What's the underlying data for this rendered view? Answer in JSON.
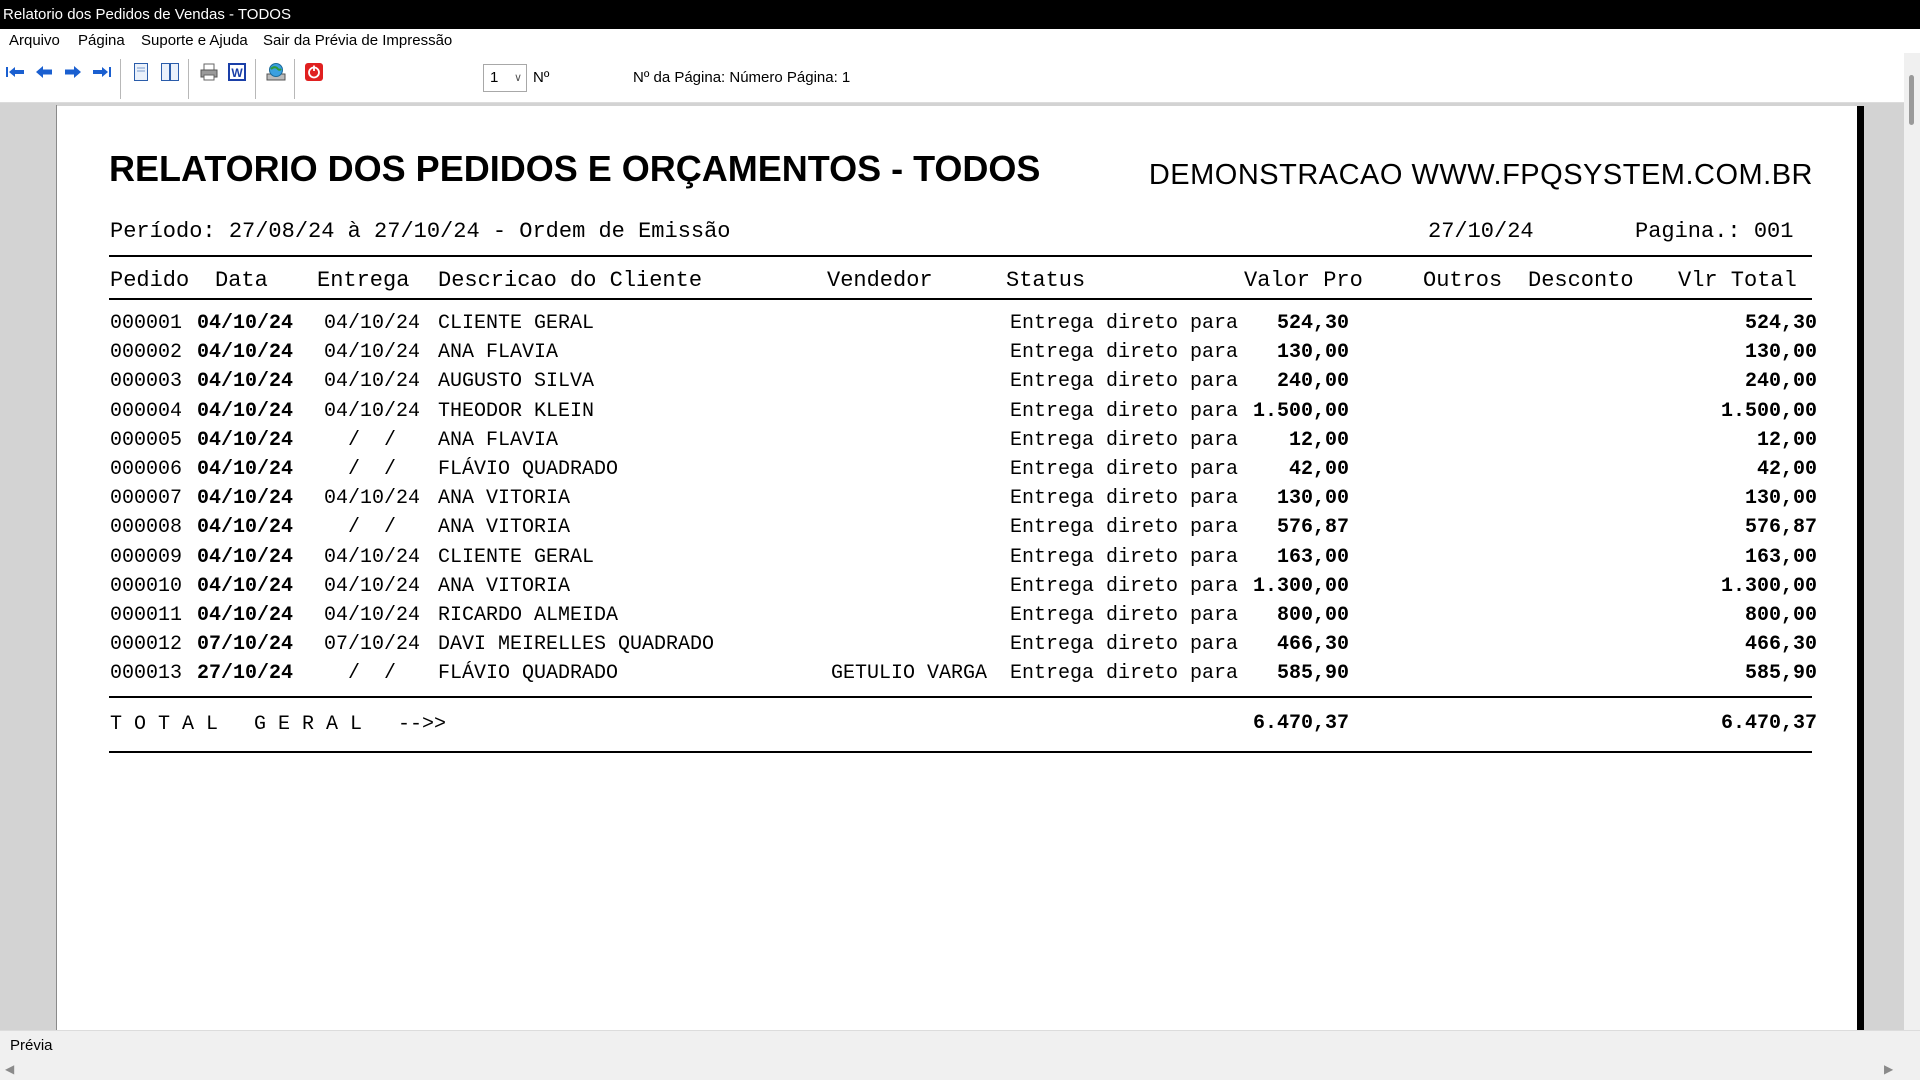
{
  "window": {
    "title": "Relatorio dos Pedidos de Vendas - TODOS"
  },
  "menu": {
    "items": [
      "Arquivo",
      "Página",
      "Suporte e Ajuda",
      "Sair da Prévia de Impressão"
    ]
  },
  "toolbar": {
    "page_value": "1",
    "page_suffix": "Nº",
    "page_info": "Nº da Página: Número Página: 1",
    "icons": [
      "first-page-icon",
      "prev-page-icon",
      "next-page-icon",
      "last-page-icon",
      "single-page-icon",
      "two-page-icon",
      "print-icon",
      "word-export-icon",
      "web-export-icon",
      "close-preview-icon"
    ],
    "colors": {
      "nav_arrow": "#1a5fd0",
      "word": "#1a3fa8",
      "stop": "#e02020"
    }
  },
  "report": {
    "title": "RELATORIO DOS PEDIDOS E ORÇAMENTOS - TODOS",
    "company": "DEMONSTRACAO WWW.FPQSYSTEM.COM.BR",
    "period": "Período: 27/08/24 à 27/10/24 - Ordem de Emissão",
    "date": "27/10/24",
    "page": "Pagina.: 001",
    "columns": {
      "pedido": "Pedido",
      "data": "Data",
      "entrega": "Entrega",
      "cliente": "Descricao do Cliente",
      "vendedor": "Vendedor",
      "status": "Status",
      "valor": "Valor Pro",
      "outros": "Outros",
      "desconto": "Desconto",
      "total": "Vlr Total"
    },
    "rows": [
      {
        "pedido": "000001",
        "data": "04/10/24",
        "entrega": "04/10/24",
        "cliente": "CLIENTE GERAL",
        "vendedor": "",
        "status": "Entrega direto para",
        "valor": "524,30",
        "total": "524,30"
      },
      {
        "pedido": "000002",
        "data": "04/10/24",
        "entrega": "04/10/24",
        "cliente": "ANA FLAVIA",
        "vendedor": "",
        "status": "Entrega direto para",
        "valor": "130,00",
        "total": "130,00"
      },
      {
        "pedido": "000003",
        "data": "04/10/24",
        "entrega": "04/10/24",
        "cliente": "AUGUSTO SILVA",
        "vendedor": "",
        "status": "Entrega direto para",
        "valor": "240,00",
        "total": "240,00"
      },
      {
        "pedido": "000004",
        "data": "04/10/24",
        "entrega": "04/10/24",
        "cliente": "THEODOR KLEIN",
        "vendedor": "",
        "status": "Entrega direto para",
        "valor": "1.500,00",
        "total": "1.500,00"
      },
      {
        "pedido": "000005",
        "data": "04/10/24",
        "entrega": "  /  /",
        "cliente": "ANA FLAVIA",
        "vendedor": "",
        "status": "Entrega direto para",
        "valor": "12,00",
        "total": "12,00"
      },
      {
        "pedido": "000006",
        "data": "04/10/24",
        "entrega": "  /  /",
        "cliente": "FLÁVIO QUADRADO",
        "vendedor": "",
        "status": "Entrega direto para",
        "valor": "42,00",
        "total": "42,00"
      },
      {
        "pedido": "000007",
        "data": "04/10/24",
        "entrega": "04/10/24",
        "cliente": "ANA VITORIA",
        "vendedor": "",
        "status": "Entrega direto para",
        "valor": "130,00",
        "total": "130,00"
      },
      {
        "pedido": "000008",
        "data": "04/10/24",
        "entrega": "  /  /",
        "cliente": "ANA VITORIA",
        "vendedor": "",
        "status": "Entrega direto para",
        "valor": "576,87",
        "total": "576,87"
      },
      {
        "pedido": "000009",
        "data": "04/10/24",
        "entrega": "04/10/24",
        "cliente": "CLIENTE GERAL",
        "vendedor": "",
        "status": "Entrega direto para",
        "valor": "163,00",
        "total": "163,00"
      },
      {
        "pedido": "000010",
        "data": "04/10/24",
        "entrega": "04/10/24",
        "cliente": "ANA VITORIA",
        "vendedor": "",
        "status": "Entrega direto para",
        "valor": "1.300,00",
        "total": "1.300,00"
      },
      {
        "pedido": "000011",
        "data": "04/10/24",
        "entrega": "04/10/24",
        "cliente": "RICARDO ALMEIDA",
        "vendedor": "",
        "status": "Entrega direto para",
        "valor": "800,00",
        "total": "800,00"
      },
      {
        "pedido": "000012",
        "data": "07/10/24",
        "entrega": "07/10/24",
        "cliente": "DAVI MEIRELLES QUADRADO",
        "vendedor": "",
        "status": "Entrega direto para",
        "valor": "466,30",
        "total": "466,30"
      },
      {
        "pedido": "000013",
        "data": "27/10/24",
        "entrega": "  /  /",
        "cliente": "FLÁVIO QUADRADO",
        "vendedor": "GETULIO VARGA",
        "status": "Entrega direto para",
        "valor": "585,90",
        "total": "585,90"
      }
    ],
    "total_label": "T O T A L   G E R A L   -->>",
    "total_valor": "6.470,37",
    "total_total": "6.470,37"
  },
  "statusbar": {
    "text": "Prévia"
  }
}
